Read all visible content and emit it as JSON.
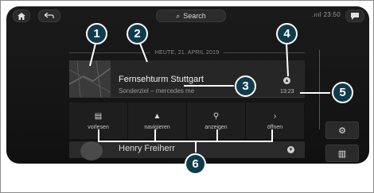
{
  "topbar": {
    "search_label": "Search",
    "status_text": ".ıııl 23:50"
  },
  "list": {
    "date_header": "HEUTE, 21. APRIL 2019",
    "entry": {
      "title": "Fernsehturm Stuttgart",
      "subtitle": "Sonderziel – mercedes me",
      "time": "13:23"
    },
    "actions": [
      {
        "label": "vorlesen",
        "icon": "read-aloud-icon"
      },
      {
        "label": "navigieren",
        "icon": "navigate-arrow-icon"
      },
      {
        "label": "anzeigen",
        "icon": "show-location-icon"
      },
      {
        "label": "öffnen",
        "icon": "chevron-right-icon"
      }
    ],
    "next_entry": {
      "title": "Henry Freiherr"
    }
  },
  "callouts": [
    "1",
    "2",
    "3",
    "4",
    "5",
    "6"
  ]
}
